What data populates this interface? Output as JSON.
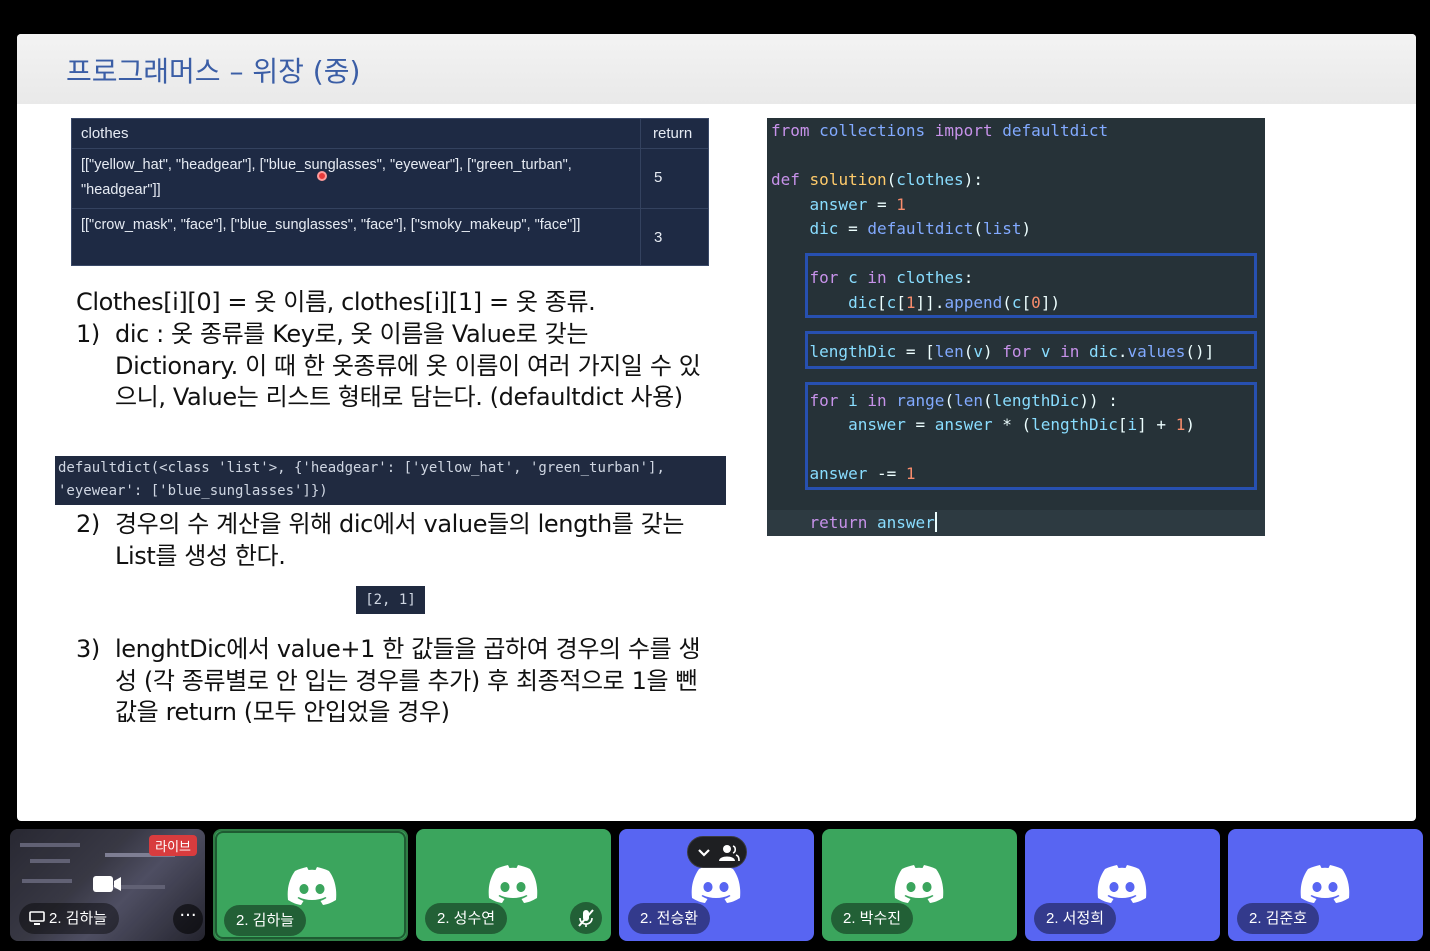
{
  "slide": {
    "title": "프로그래머스 – 위장 (중)"
  },
  "table": {
    "headers": [
      "clothes",
      "return"
    ],
    "rows": [
      {
        "clothes": "[[\"yellow_hat\", \"headgear\"], [\"blue_sunglasses\", \"eyewear\"], [\"green_turban\", \"headgear\"]]",
        "return": "5"
      },
      {
        "clothes": "[[\"crow_mask\", \"face\"], [\"blue_sunglasses\", \"face\"], [\"smoky_makeup\", \"face\"]]",
        "return": "3"
      }
    ]
  },
  "explanation": {
    "intro": "Clothes[i][0] = 옷 이름, clothes[i][1] = 옷 종류.",
    "steps": [
      {
        "num": "1)",
        "text": "dic : 옷 종류를 Key로, 옷 이름을 Value로 갖는 Dictionary. 이 때 한 옷종류에 옷 이름이 여러 가지일 수 있으니, Value는 리스트 형태로 담는다. (defaultdict 사용)"
      },
      {
        "num": "2)",
        "text": "경우의 수 계산을 위해 dic에서 value들의 length를 갖는 List를 생성 한다."
      },
      {
        "num": "3)",
        "text": "lenghtDic에서 value+1 한 값들을 곱하여 경우의 수를 생성 (각 종류별로 안 입는 경우를 추가) 후 최종적으로 1을 뺀 값을 return (모두 안입었을 경우)"
      }
    ],
    "dd_output": "defaultdict(<class 'list'>, {'headgear': ['yellow_hat', 'green_turban'], 'eyewear': ['blue_sunglasses']})",
    "len_output": "[2, 1]"
  },
  "code": {
    "lines": [
      "from collections import defaultdict",
      "",
      "def solution(clothes):",
      "    answer = 1",
      "    dic = defaultdict(list)",
      "",
      "    for c in clothes:",
      "        dic[c[1]].append(c[0])",
      "",
      "    lengthDic = [len(v) for v in dic.values()]",
      "",
      "    for i in range(len(lengthDic)) :",
      "        answer = answer * (lengthDic[i] + 1)",
      "",
      "    answer -= 1",
      "",
      "    return answer"
    ]
  },
  "participants": [
    {
      "name": "2. 김하늘",
      "type": "screen",
      "badge": "라이브"
    },
    {
      "name": "2. 김하늘",
      "type": "green"
    },
    {
      "name": "2. 성수연",
      "type": "green",
      "muted": true
    },
    {
      "name": "2. 전승환",
      "type": "blue"
    },
    {
      "name": "2. 박수진",
      "type": "green"
    },
    {
      "name": "2. 서정희",
      "type": "blue"
    },
    {
      "name": "2. 김준호",
      "type": "blue"
    }
  ],
  "colors": {
    "title": "#3b5ea6",
    "discord_green": "#3ba55d",
    "discord_blurple": "#5865f2",
    "code_bg": "#263238",
    "highlight_box": "#2750b0",
    "live_red": "#d83c3e"
  },
  "icons": [
    "monitor-icon",
    "camera-icon",
    "more-icon",
    "mic-muted-icon",
    "discord-logo-icon",
    "chevron-down-icon",
    "people-icon"
  ]
}
